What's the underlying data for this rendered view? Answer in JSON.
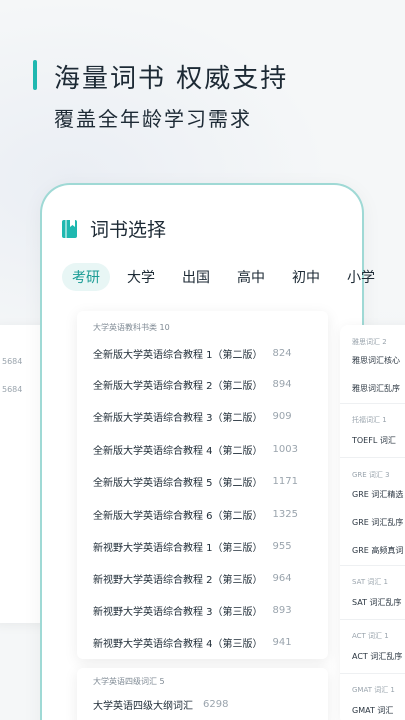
{
  "hero": {
    "title": "海量词书 权威支持",
    "subtitle": "覆盖全年龄学习需求",
    "accent_color": "#1fb8b0"
  },
  "phone": {
    "title": "词书选择",
    "title_icon": "book-icon",
    "tabs": [
      {
        "label": "考研",
        "active": true
      },
      {
        "label": "大学",
        "active": false
      },
      {
        "label": "出国",
        "active": false
      },
      {
        "label": "高中",
        "active": false
      },
      {
        "label": "初中",
        "active": false
      },
      {
        "label": "小学",
        "active": false
      }
    ]
  },
  "left_card": {
    "values": [
      "5684",
      "5684"
    ]
  },
  "main_list": {
    "group1_label": "大学英语教科书类 10",
    "books": [
      {
        "name": "全新版大学英语综合教程 1（第二版）",
        "count": "824"
      },
      {
        "name": "全新版大学英语综合教程 2（第二版）",
        "count": "894"
      },
      {
        "name": "全新版大学英语综合教程 3（第二版）",
        "count": "909"
      },
      {
        "name": "全新版大学英语综合教程 4（第二版）",
        "count": "1003"
      },
      {
        "name": "全新版大学英语综合教程 5（第二版）",
        "count": "1171"
      },
      {
        "name": "全新版大学英语综合教程 6（第二版）",
        "count": "1325"
      },
      {
        "name": "新视野大学英语综合教程 1（第三版）",
        "count": "955"
      },
      {
        "name": "新视野大学英语综合教程 2（第三版）",
        "count": "964"
      },
      {
        "name": "新视野大学英语综合教程 3（第三版）",
        "count": "893"
      },
      {
        "name": "新视野大学英语综合教程 4（第三版）",
        "count": "941"
      }
    ],
    "group2_label": "大学英语四级词汇 5",
    "group2_books": [
      {
        "name": "大学英语四级大纲词汇",
        "count": "6298"
      }
    ]
  },
  "right_card": {
    "groups": [
      {
        "label": "雅思词汇 2",
        "items": [
          "雅思词汇核心",
          "雅思词汇乱序"
        ]
      },
      {
        "label": "托福词汇 1",
        "items": [
          "TOEFL 词汇"
        ]
      },
      {
        "label": "GRE 词汇 3",
        "items": [
          "GRE 词汇精选",
          "GRE 词汇乱序",
          "GRE 高频真词"
        ]
      },
      {
        "label": "SAT 词汇 1",
        "items": [
          "SAT 词汇乱序"
        ]
      },
      {
        "label": "ACT 词汇 1",
        "items": [
          "ACT 词汇乱序"
        ]
      },
      {
        "label": "GMAT 词汇 1",
        "items": [
          "GMAT 词汇"
        ]
      }
    ]
  }
}
